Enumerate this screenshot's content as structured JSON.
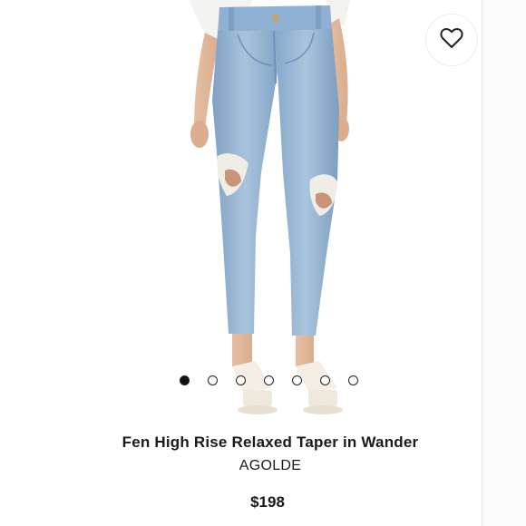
{
  "product": {
    "title": "Fen High Rise Relaxed Taper in Wander",
    "brand": "AGOLDE",
    "price": "$198",
    "image_description_icon": "jeans-photo",
    "favorite_icon": "heart-icon"
  },
  "carousel": {
    "total_images": 7,
    "active_index": 0
  },
  "colors": {
    "denim": "#8fb0d0",
    "text": "#1a1a1a",
    "dot_active": "#111111"
  }
}
